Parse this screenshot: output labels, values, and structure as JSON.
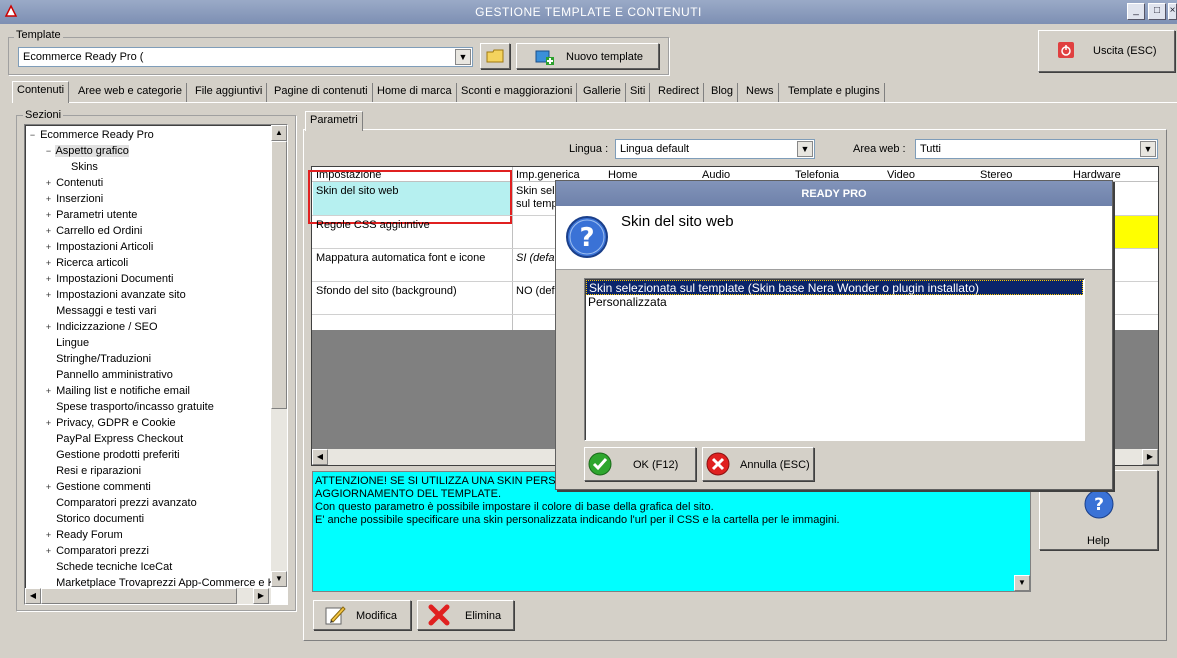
{
  "window": {
    "title": "GESTIONE TEMPLATE E CONTENUTI"
  },
  "template": {
    "label": "Template",
    "selected": "Ecommerce Ready Pro (",
    "new_button": "Nuovo template"
  },
  "exit_button": "Uscita (ESC)",
  "tabs": [
    "Contenuti",
    "Aree web e categorie",
    "File aggiuntivi",
    "Pagine di contenuti",
    "Home di marca",
    "Sconti e maggiorazioni",
    "Gallerie",
    "Siti",
    "Redirect",
    "Blog",
    "News",
    "Template e plugins"
  ],
  "sidebar": {
    "label": "Sezioni",
    "root": "Ecommerce Ready Pro",
    "items": [
      "Aspetto grafico",
      "Skins",
      "Contenuti",
      "Inserzioni",
      "Parametri utente",
      "Carrello ed Ordini",
      "Impostazioni Articoli",
      "Ricerca articoli",
      "Impostazioni Documenti",
      "Impostazioni avanzate sito",
      "Messaggi e testi vari",
      "Indicizzazione / SEO",
      "Lingue",
      "Stringhe/Traduzioni",
      "Pannello amministrativo",
      "Mailing list e notifiche email",
      "Spese trasporto/incasso gratuite",
      "Privacy, GDPR e Cookie",
      "PayPal Express Checkout",
      "Gestione prodotti preferiti",
      "Resi e riparazioni",
      "Gestione commenti",
      "Comparatori prezzi avanzato",
      "Storico documenti",
      "Ready Forum",
      "Comparatori prezzi",
      "Schede tecniche IceCat",
      "Marketplace Trovaprezzi App-Commerce e Ki"
    ]
  },
  "params": {
    "tab": "Parametri",
    "lingua_label": "Lingua :",
    "lingua_value": "Lingua default",
    "area_label": "Area web :",
    "area_value": "Tutti",
    "columns": [
      "Impostazione",
      "Imp.generica",
      "Home",
      "Audio",
      "Telefonia",
      "Video",
      "Stereo",
      "Hardware"
    ],
    "rows": [
      {
        "name": "Skin del sito web",
        "value": "Skin sele",
        "value2": "sul temp"
      },
      {
        "name": "Regole CSS aggiuntive",
        "value": ""
      },
      {
        "name": "Mappatura automatica font e icone",
        "value": "SI (defa"
      },
      {
        "name": "Sfondo del sito (background)",
        "value": "NO (def"
      }
    ]
  },
  "info_text": {
    "line1": "ATTENZIONE! SE SI UTILIZZA UNA SKIN PERSONA",
    "line2": "AGGIORNAMENTO DEL TEMPLATE.",
    "line3": "Con questo parametro è possibile impostare il colore di base della grafica del sito.",
    "line4": "E' anche possibile specificare una skin personalizzata indicando l'url per il CSS e la cartella per le immagini."
  },
  "buttons": {
    "modify": "Modifica",
    "delete": "Elimina",
    "help": "Help"
  },
  "dialog": {
    "title": "READY PRO",
    "heading": "Skin del sito web",
    "options": [
      "Skin selezionata sul template (Skin base Nera Wonder o plugin installato)",
      "Personalizzata"
    ],
    "ok": "OK (F12)",
    "cancel": "Annulla (ESC)"
  },
  "colors": {
    "accent_selected": "#0a246a",
    "highlight_cell": "#b6f0f0",
    "info_bg": "#00ffff",
    "yellow": "#ffff00"
  }
}
